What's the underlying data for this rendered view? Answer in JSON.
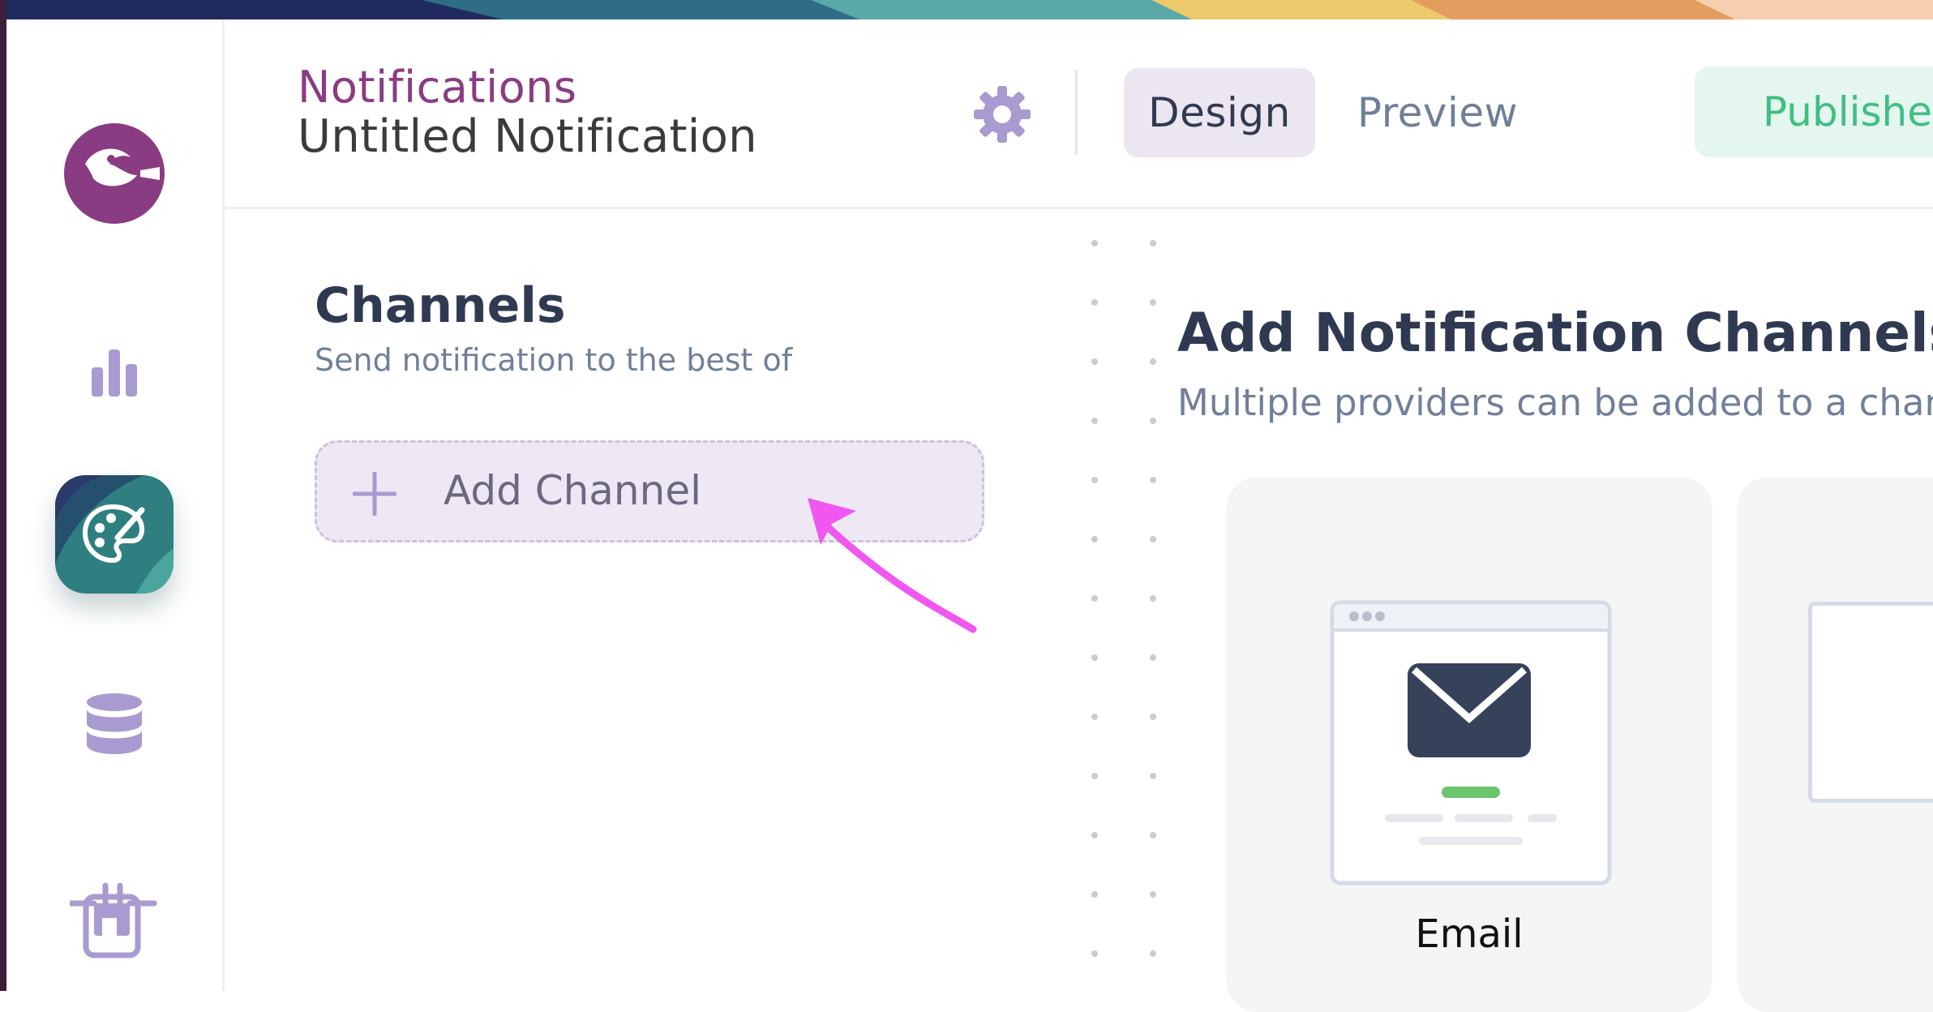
{
  "header": {
    "breadcrumb": "Notifications",
    "title": "Untitled Notification",
    "tabs": [
      {
        "label": "Design",
        "active": true
      },
      {
        "label": "Preview",
        "active": false
      }
    ],
    "status": "Published"
  },
  "sidebar": {
    "items": [
      {
        "icon": "logo-icon"
      },
      {
        "icon": "bar-chart-icon"
      },
      {
        "icon": "palette-icon",
        "active": true
      },
      {
        "icon": "database-icon"
      },
      {
        "icon": "plug-icon"
      }
    ]
  },
  "channels": {
    "title": "Channels",
    "subtitle": "Send notification to the best of",
    "add_label": "Add Channel"
  },
  "main": {
    "title": "Add Notification Channels",
    "subtitle": "Multiple providers can be added to a chann",
    "cards": [
      {
        "label": "Email"
      }
    ]
  },
  "colors": {
    "brand": "#8a3c82",
    "accent": "#a99ad0",
    "heading": "#2f3a52",
    "published": "#3fbf82",
    "annotation": "#f057f0"
  }
}
